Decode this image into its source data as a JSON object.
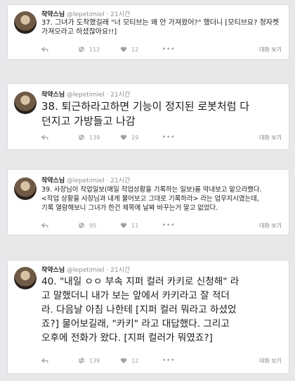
{
  "tweets": [
    {
      "name": "작약스님",
      "handle": "@lepetimiel",
      "time": "21시간",
      "lines": [
        "37. 그녀가 도착했길래 \"너 모티브는 왜 안 가져왔어?\" 했더니 [모티브요? 청자켓",
        "가져오라고 하셨잖아요!!]"
      ],
      "retweets": "112",
      "likes": "12",
      "dm_label": "대화 보기"
    },
    {
      "name": "작약스님",
      "handle": "@lepetimiel",
      "time": "21시간",
      "lines": [
        "38. 퇴근하라고하면 기능이 정지된 로봇처럼 다",
        "던지고 가방들고 나감"
      ],
      "retweets": "139",
      "likes": "19",
      "dm_label": "대화 보기"
    },
    {
      "name": "작약스님",
      "handle": "@lepetimiel",
      "time": "21시간",
      "lines": [
        "39. 사장님이 작업일보(매일 작업상황을 기록하는 일보)를 막내보고 맡으라했다.",
        "<작업 상황을 사장님과 내게 물어보고 그대로 기록하라> 라는 업무지시였는데,",
        "기록 열람해보니 그녀가 한건 제목에 날짜 바꾸는거 말고 없었다."
      ],
      "retweets": "95",
      "likes": "11",
      "dm_label": "대화 보기"
    },
    {
      "name": "작약스님",
      "handle": "@lepetimiel",
      "time": "21시간",
      "lines": [
        "40. \"내일 ㅇㅇ 부속 지퍼 컬러 카키로 신청해\" 라",
        "고 말했더니 내가 보는 앞에서 카키라고 잘 적더",
        "라. 다음날 아침 나한테 [지퍼 컬러 뭐라고 하셨었",
        "죠?] 물어보길래, \"카키\" 라고 대답했다. 그리고",
        "오후에 전화가 왔다. [지퍼 컬러가 뭐였죠?]"
      ],
      "retweets": "139",
      "likes": "12",
      "dm_label": "대화 보기"
    }
  ],
  "icons": [
    "reply-icon",
    "retweet-icon",
    "heart-icon",
    "more-icon"
  ],
  "colors": {
    "meta": "#8a8f94",
    "action": "#9aa0a6",
    "text": "#1c1c1c"
  }
}
